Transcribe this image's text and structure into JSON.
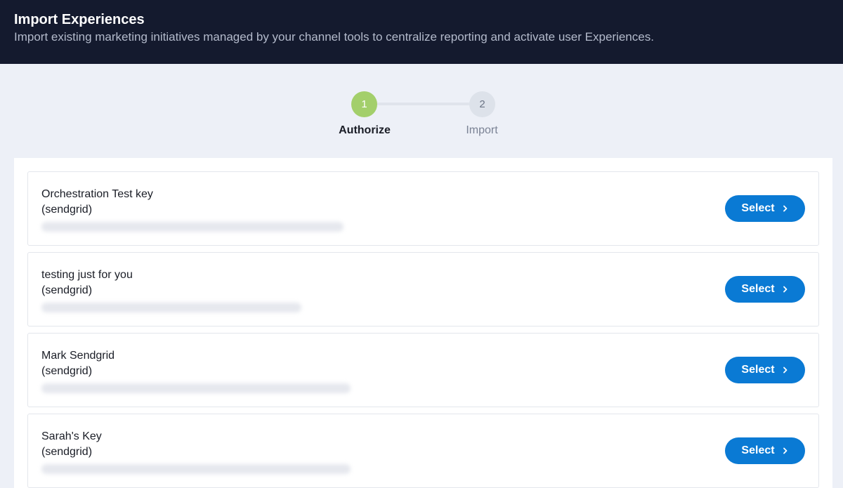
{
  "header": {
    "title": "Import Experiences",
    "subtitle": "Import existing marketing initiatives managed by your channel tools to centralize reporting and activate user Experiences."
  },
  "stepper": {
    "steps": [
      {
        "number": "1",
        "label": "Authorize"
      },
      {
        "number": "2",
        "label": "Import"
      }
    ]
  },
  "keys": [
    {
      "name": "Orchestration Test key",
      "provider": "(sendgrid)",
      "button": "Select"
    },
    {
      "name": "testing just for you",
      "provider": "(sendgrid)",
      "button": "Select"
    },
    {
      "name": "Mark Sendgrid",
      "provider": "(sendgrid)",
      "button": "Select"
    },
    {
      "name": "Sarah's Key",
      "provider": "(sendgrid)",
      "button": "Select"
    }
  ],
  "colors": {
    "header_bg": "#141a2e",
    "step_active": "#a3cf6b",
    "button_primary": "#0a7ad4"
  },
  "icons": {
    "select_button_icon": "chevron-right-icon"
  }
}
